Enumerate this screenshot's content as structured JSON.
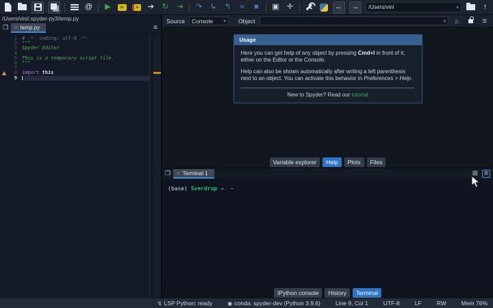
{
  "colors": {
    "accent_blue": "#2d74c4",
    "tab_underline": "#3c8ce0",
    "run_green": "#3fae4a",
    "debug_blue": "#4f8fd0",
    "string_green": "#5bb152",
    "keyword_purple": "#c678dd",
    "comment_gray": "#6e7a87",
    "warning_orange": "#e2a33a",
    "link_green": "#3fa865",
    "usage_header_blue": "#36608f",
    "terminal_green": "#2fbf71",
    "terminal_cyan": "#45c6da",
    "marker_orange": "#cf8a1d"
  },
  "toolbar": {
    "icons": [
      {
        "name": "new-file-icon",
        "cls": "ic-doc"
      },
      {
        "name": "open-file-icon",
        "cls": "ic-folder"
      },
      {
        "name": "save-icon",
        "cls": "ic-save",
        "boxed": true
      },
      {
        "name": "save-all-icon",
        "cls": "ic-save-all",
        "boxed": true
      },
      {
        "sep": true
      },
      {
        "name": "file-switcher-icon",
        "cls": "ic-bars"
      },
      {
        "name": "find-symbol-icon",
        "glyph": "@",
        "color": "#dfe5ec"
      },
      {
        "sep": true
      },
      {
        "name": "run-icon",
        "glyph": "▶",
        "color": "#3fae4a"
      },
      {
        "name": "run-cell-icon",
        "cls": "ic-cell",
        "glyph": "▶"
      },
      {
        "name": "run-cell-advance-icon",
        "cls": "ic-cell2",
        "glyph": "▶"
      },
      {
        "name": "run-selection-icon",
        "glyph": "➔",
        "color": "#cfd8e2"
      },
      {
        "name": "rerun-cell-icon",
        "glyph": "↻",
        "color": "#3fae4a"
      },
      {
        "name": "run-until-icon",
        "glyph": "⇥",
        "color": "#3fae4a"
      },
      {
        "sep": true
      },
      {
        "name": "debug-step-over-icon",
        "glyph": "↷",
        "color": "#4f8fd0"
      },
      {
        "name": "debug-step-into-icon",
        "glyph": "↳",
        "color": "#4f8fd0"
      },
      {
        "name": "debug-step-out-icon",
        "glyph": "↰",
        "color": "#4f8fd0"
      },
      {
        "name": "debug-continue-icon",
        "glyph": "»",
        "color": "#4f8fd0"
      },
      {
        "name": "debug-stop-icon",
        "glyph": "■",
        "color": "#3f7ac0"
      },
      {
        "sep": true
      },
      {
        "name": "maximize-pane-icon",
        "glyph": "▣",
        "color": "#cfd8e2"
      },
      {
        "name": "fullscreen-icon",
        "glyph": "✛",
        "color": "#cfd8e2"
      },
      {
        "sep": true
      },
      {
        "name": "preferences-icon",
        "cls": "ic-wrench"
      },
      {
        "name": "python-env-icon",
        "cls": "ic-python"
      },
      {
        "name": "back-icon",
        "glyph": "←",
        "color": "#dfe5ec",
        "boxed": true
      },
      {
        "name": "forward-icon",
        "glyph": "→",
        "color": "#dfe5ec",
        "boxed": true
      }
    ],
    "working_dir": {
      "value": "/Users/vini",
      "caret": "▾"
    },
    "open_dir_glyph": "",
    "up_dir_glyph": "↑"
  },
  "editor": {
    "breadcrumb": "/Users/vini/.spyder-py3/temp.py",
    "browse_glyph": "❐",
    "tab": {
      "label": "temp.py",
      "close": "×"
    },
    "menu_glyph": "≡",
    "lines": [
      {
        "num": "1",
        "segments": [
          {
            "t": "# -*- coding: utf-8 -*-",
            "c": "comment"
          }
        ]
      },
      {
        "num": "2",
        "segments": [
          {
            "t": "\"\"\"",
            "c": "string"
          }
        ]
      },
      {
        "num": "3",
        "segments": [
          {
            "t": "Spyder Editor",
            "c": "docstring"
          }
        ]
      },
      {
        "num": "4",
        "segments": []
      },
      {
        "num": "5",
        "segments": [
          {
            "t": "This is a temporary script file.",
            "c": "docstring"
          }
        ]
      },
      {
        "num": "6",
        "segments": [
          {
            "t": "\"\"\"",
            "c": "string"
          }
        ]
      },
      {
        "num": "7",
        "segments": []
      },
      {
        "num": "8",
        "warning": true,
        "segments": [
          {
            "t": "import",
            "c": "keyword"
          },
          {
            "t": " this",
            "c": "plain-bold"
          }
        ]
      },
      {
        "num": "9",
        "current": true,
        "segments": []
      }
    ]
  },
  "help": {
    "header": {
      "source_label": "Source",
      "source_value": "Console",
      "object_label": "Object",
      "object_value": "",
      "caret": "▾",
      "home_glyph": "⌂",
      "menu_glyph": "≡"
    },
    "usage": {
      "title": "Usage",
      "p1_pre": "Here you can get help of any object by pressing ",
      "p1_kbd": "Cmd+I",
      "p1_post": " in front of it, either on the Editor or the Console.",
      "p2_pre": "Help can also be shown automatically after writing a left parenthesis next to an object. You can activate this behavior in ",
      "p2_em": "Preferences > Help",
      "p2_post": ".",
      "footer_pre": "New to Spyder? Read our ",
      "footer_link": "tutorial"
    },
    "tabs": [
      {
        "label": "Variable explorer",
        "name": "tab-variable-explorer"
      },
      {
        "label": "Help",
        "active": true,
        "name": "tab-help"
      },
      {
        "label": "Plots",
        "name": "tab-plots"
      },
      {
        "label": "Files",
        "name": "tab-files"
      }
    ]
  },
  "terminal": {
    "browse_glyph": "❐",
    "tab": {
      "label": "Terminal 1",
      "close": "×"
    },
    "new_glyph": "⊞",
    "menu_glyph": "≡",
    "prompt": [
      {
        "t": "(base) ",
        "c": "t-plain"
      },
      {
        "t": "Sverdrup",
        "c": "t-green"
      },
      {
        "t": " → ",
        "c": "t-green"
      },
      {
        "t": " ~",
        "c": "t-cyan"
      }
    ]
  },
  "console_tabs": [
    {
      "label": "IPython console",
      "name": "tab-ipython-console"
    },
    {
      "label": "History",
      "name": "tab-history"
    },
    {
      "label": "Terminal",
      "active": true,
      "name": "tab-terminal"
    }
  ],
  "statusbar": {
    "items": [
      {
        "icon": "↯",
        "label": "LSP Python: ready",
        "name": "status-lsp"
      },
      {
        "icon": "◉",
        "label": "conda: spyder-dev (Python 3.9.6)",
        "name": "status-conda"
      },
      {
        "label": "Line 9, Col 1",
        "name": "status-cursor-position"
      },
      {
        "label": "UTF-8",
        "name": "status-encoding"
      },
      {
        "label": "LF",
        "name": "status-eol"
      },
      {
        "label": "RW",
        "name": "status-permissions"
      },
      {
        "label": "Mem 76%",
        "name": "status-memory"
      }
    ]
  }
}
